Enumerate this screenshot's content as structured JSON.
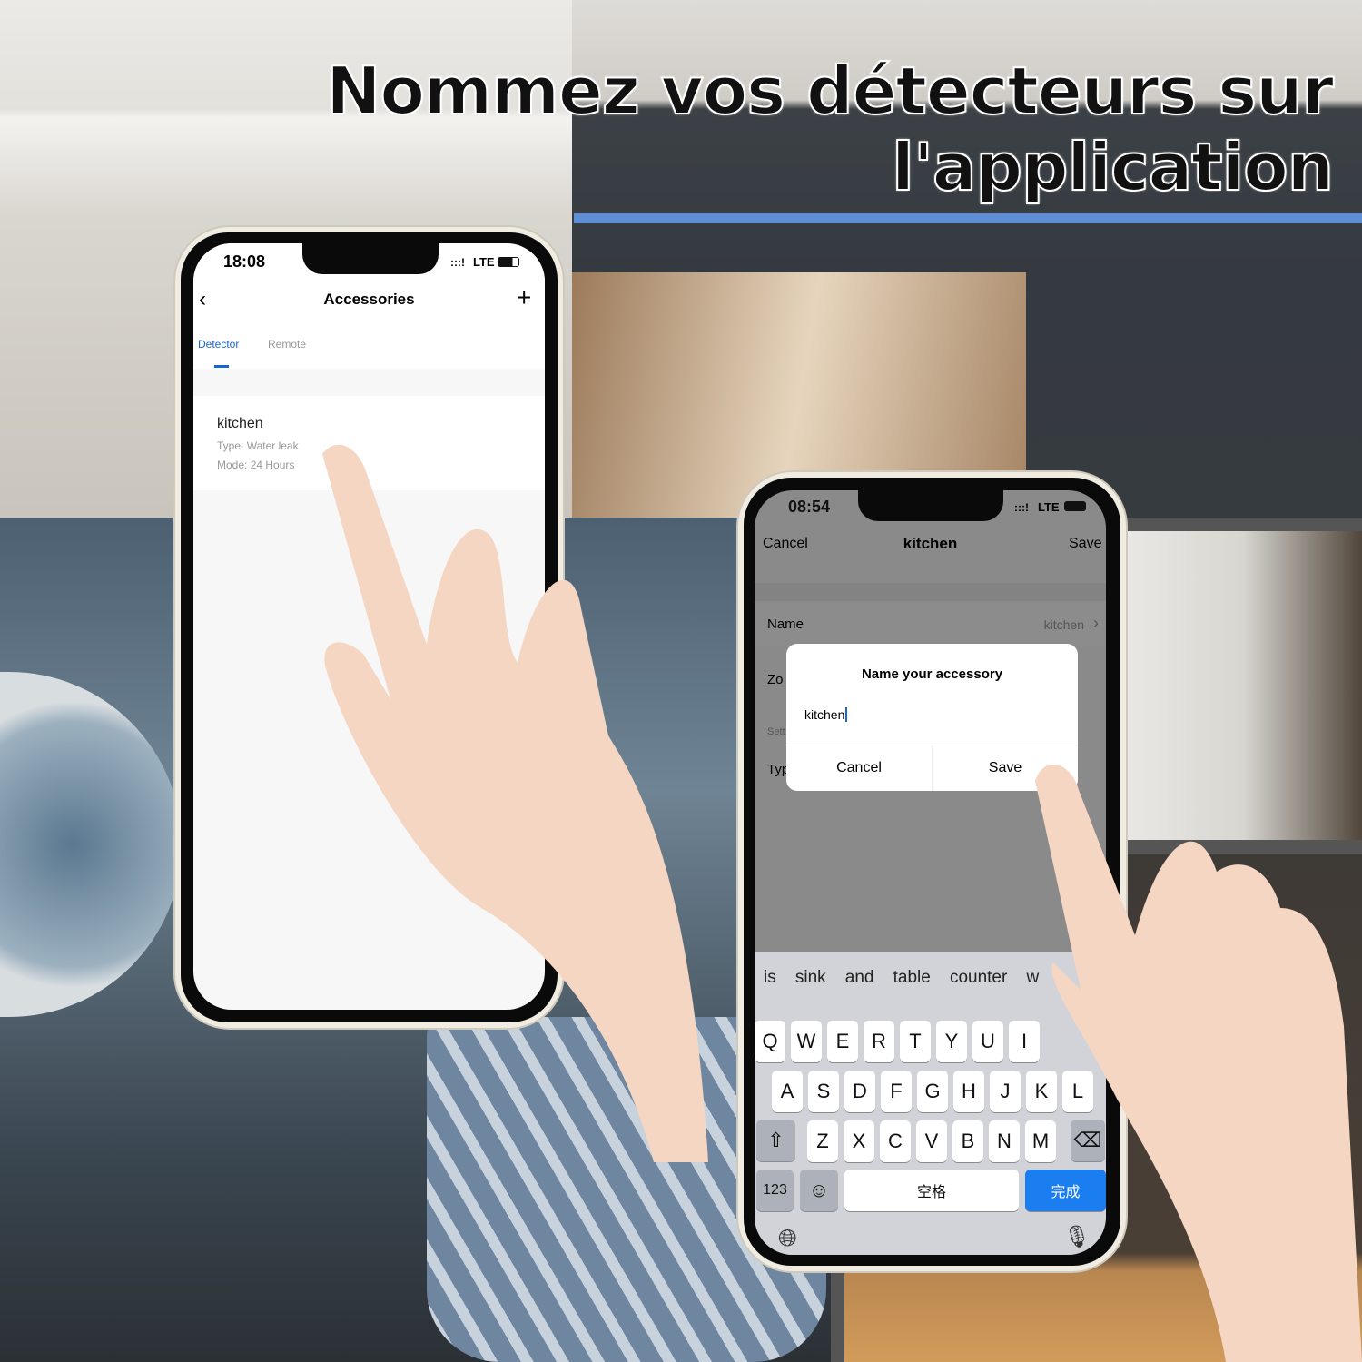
{
  "headline": {
    "line1": "Nommez vos détecteurs sur",
    "line2": "l'application"
  },
  "colors": {
    "accent_rule": "#5e8ed6",
    "tab_active": "#1a66d1",
    "key_done": "#1a7df0"
  },
  "phone_left": {
    "status": {
      "time": "18:08",
      "network": "LTE"
    },
    "nav": {
      "title": "Accessories",
      "back_icon": "chevron-left-icon",
      "add_icon": "plus-icon"
    },
    "tabs": [
      {
        "label": "Detector",
        "active": true
      },
      {
        "label": "Remote",
        "active": false
      }
    ],
    "accessory": {
      "name": "kitchen",
      "type_label": "Type:",
      "type_value": "Water leak",
      "mode_label": "Mode:",
      "mode_value": "24 Hours"
    }
  },
  "phone_right": {
    "status": {
      "time": "08:54",
      "network": "LTE"
    },
    "nav": {
      "cancel": "Cancel",
      "title": "kitchen",
      "save": "Save"
    },
    "rows": {
      "name_label": "Name",
      "name_value": "kitchen",
      "zone_partial": "Zo",
      "settings_partial": "Sett",
      "type_partial": "Typ"
    },
    "dialog": {
      "title": "Name your accessory",
      "input_value": "kitchen",
      "cancel": "Cancel",
      "save": "Save"
    },
    "suggestions": [
      "is",
      "sink",
      "and",
      "table",
      "counter",
      "w"
    ],
    "keyboard": {
      "row1": [
        "Q",
        "W",
        "E",
        "R",
        "T",
        "Y",
        "U",
        "I"
      ],
      "row2": [
        "A",
        "S",
        "D",
        "F",
        "G",
        "H",
        "J",
        "K",
        "L"
      ],
      "row3": [
        "Z",
        "X",
        "C",
        "V",
        "B",
        "N",
        "M"
      ],
      "numbers": "123",
      "space": "空格",
      "done": "完成"
    }
  }
}
